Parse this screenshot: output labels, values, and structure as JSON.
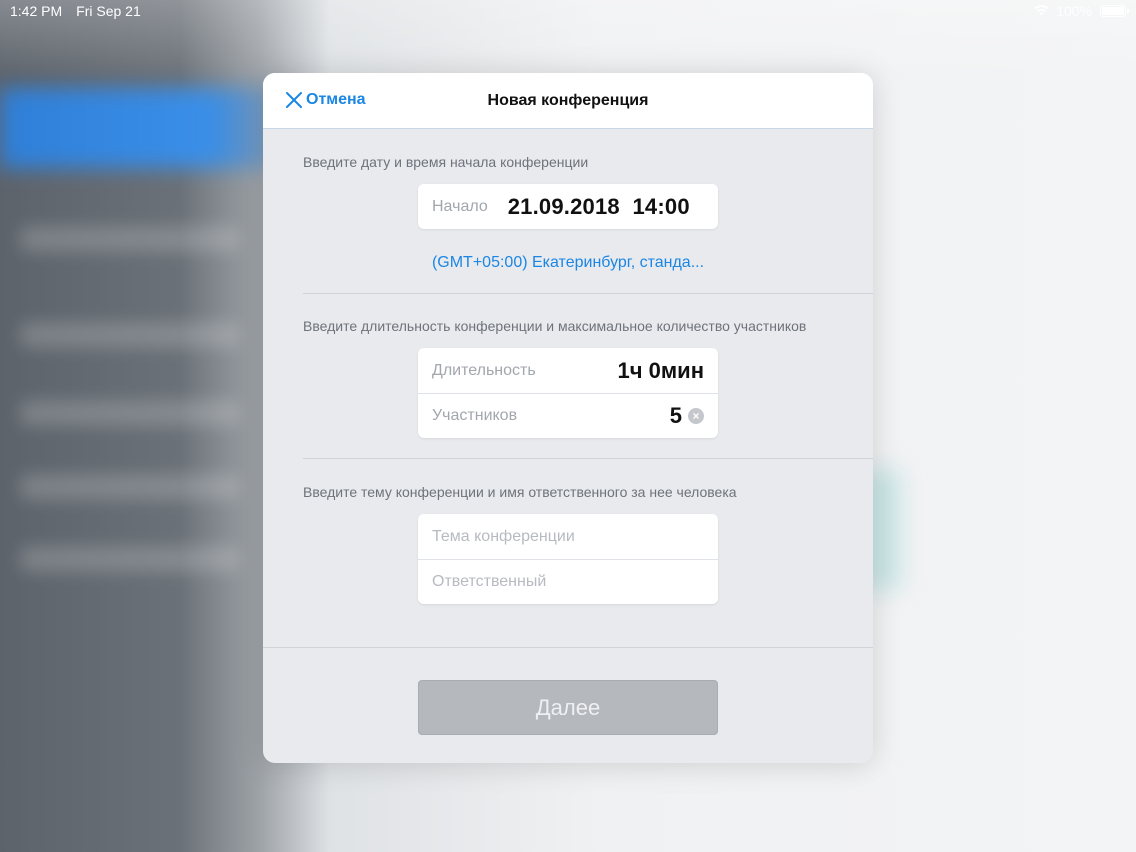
{
  "status_bar": {
    "time": "1:42 PM",
    "date": "Fri Sep 21",
    "battery": "100%",
    "icons": [
      "wifi-icon",
      "battery-icon"
    ]
  },
  "modal": {
    "cancel_label": "Отмена",
    "title": "Новая конференция",
    "start_section": {
      "label": "Введите дату и время начала конференции",
      "field_label": "Начало",
      "value": "21.09.2018  14:00",
      "timezone": "(GMT+05:00) Екатеринбург, станда..."
    },
    "duration_section": {
      "label": "Введите длительность конференции и максимальное количество участников",
      "duration_label": "Длительность",
      "duration_value": "1ч 0мин",
      "participants_label": "Участников",
      "participants_value": "5"
    },
    "topic_section": {
      "label": "Введите тему конференции и имя ответственного за нее человека",
      "topic_placeholder": "Тема конференции",
      "responsible_placeholder": "Ответственный"
    },
    "next_label": "Далее"
  },
  "colors": {
    "accent": "#1b86e3",
    "disabled_button": "#b5b8bc"
  }
}
